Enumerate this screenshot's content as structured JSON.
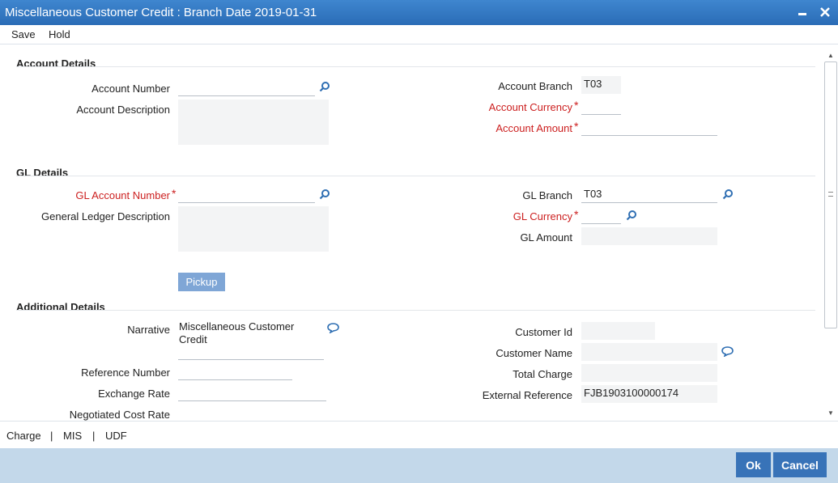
{
  "window": {
    "title": "Miscellaneous Customer Credit : Branch Date 2019-01-31"
  },
  "menu": {
    "save": "Save",
    "hold": "Hold"
  },
  "sections": {
    "account": "Account Details",
    "gl": "GL Details",
    "additional": "Additional Details"
  },
  "account": {
    "number_label": "Account Number",
    "number_value": "",
    "description_label": "Account Description",
    "branch_label": "Account Branch",
    "branch_value": "T03",
    "currency_label": "Account Currency",
    "currency_value": "",
    "amount_label": "Account Amount",
    "amount_value": "",
    "required_mark": "*"
  },
  "gl": {
    "number_label": "GL Account Number",
    "number_value": "",
    "description_label": "General Ledger Description",
    "branch_label": "GL Branch",
    "branch_value": "T03",
    "currency_label": "GL Currency",
    "currency_value": "",
    "amount_label": "GL Amount",
    "pickup_label": "Pickup"
  },
  "additional": {
    "narrative_label": "Narrative",
    "narrative_value": "Miscellaneous Customer Credit",
    "reference_label": "Reference Number",
    "reference_value": "",
    "exchange_rate_label": "Exchange Rate",
    "exchange_rate_value": "",
    "negotiated_rate_label": "Negotiated Cost Rate",
    "customer_id_label": "Customer Id",
    "customer_name_label": "Customer Name",
    "total_charge_label": "Total Charge",
    "external_ref_label": "External Reference",
    "external_ref_value": "FJB1903100000174"
  },
  "tabs": {
    "charge": "Charge",
    "mis": "MIS",
    "udf": "UDF",
    "separator": "|"
  },
  "footer": {
    "ok": "Ok",
    "cancel": "Cancel"
  },
  "icons": {
    "minimize": "minimize-icon",
    "close": "close-icon",
    "search": "search-icon",
    "comment": "comment-icon"
  },
  "colors": {
    "titlebar": "#2f76c2",
    "required": "#cc1f1f",
    "footer": "#c3d8ea",
    "button": "#3873b8",
    "pickup": "#7fa6d6"
  }
}
